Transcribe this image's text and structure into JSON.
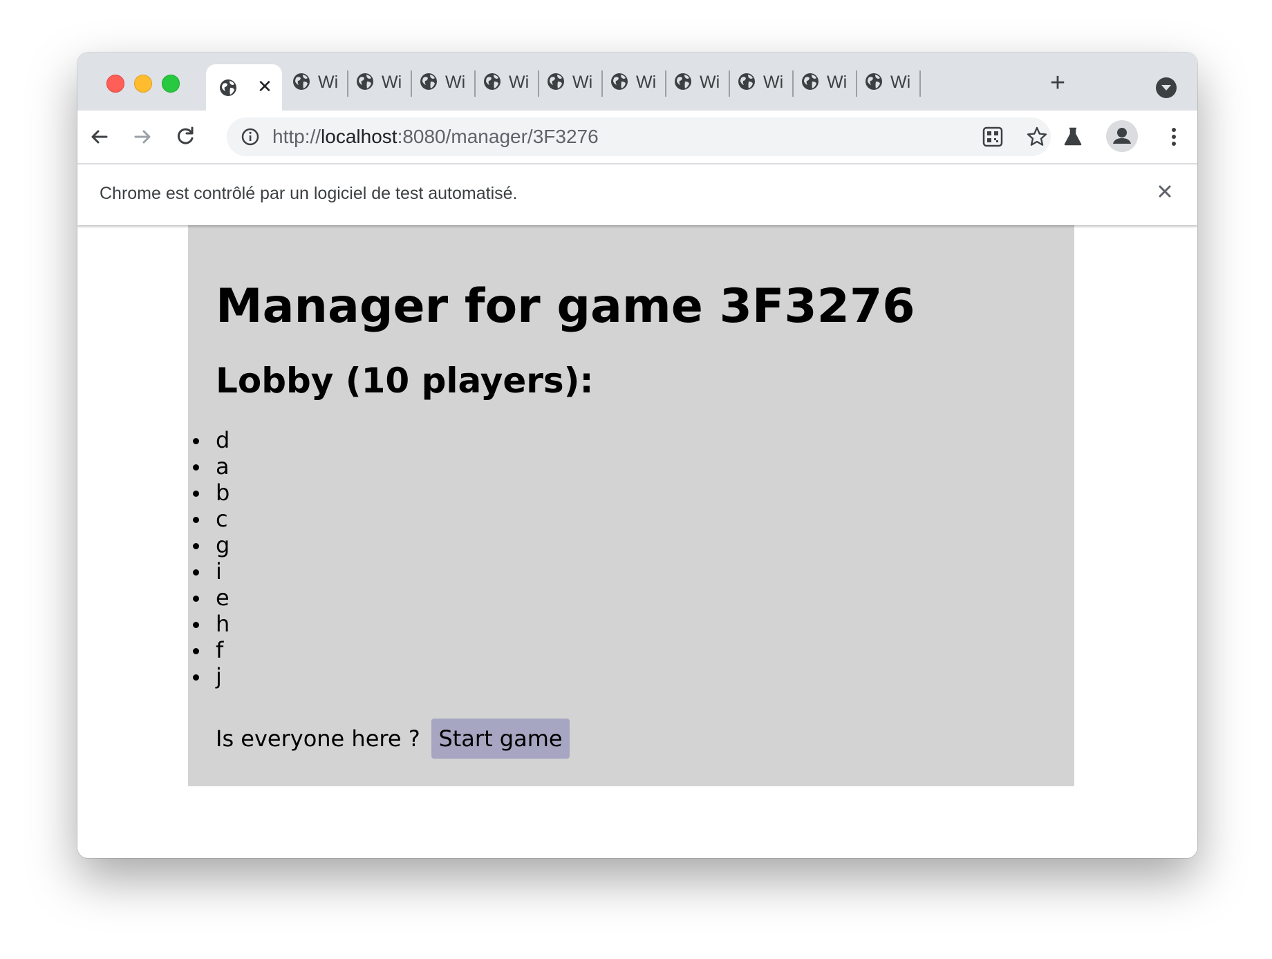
{
  "browser": {
    "active_tab": {
      "close_glyph": "✕",
      "icon": "globe-icon"
    },
    "tabs": [
      {
        "title": "Wi"
      },
      {
        "title": "Wi"
      },
      {
        "title": "Wi"
      },
      {
        "title": "Wi"
      },
      {
        "title": "Wi"
      },
      {
        "title": "Wi"
      },
      {
        "title": "Wi"
      },
      {
        "title": "Wi"
      },
      {
        "title": "Wi"
      },
      {
        "title": "Wi"
      }
    ],
    "new_tab_glyph": "+",
    "url_prefix": "http://",
    "url_host": "localhost",
    "url_rest": ":8080/manager/3F3276",
    "infobar_text": "Chrome est contrôlé par un logiciel de test automatisé."
  },
  "page": {
    "title": "Manager for game 3F3276",
    "lobby_heading": "Lobby (10 players):",
    "players": [
      "d",
      "a",
      "b",
      "c",
      "g",
      "i",
      "e",
      "h",
      "f",
      "j"
    ],
    "question": "Is everyone here ?",
    "start_button": "Start game"
  },
  "colors": {
    "panel_bg": "#d3d3d3",
    "button_bg": "#a6a6c2",
    "tabstrip_bg": "#dee1e6"
  }
}
